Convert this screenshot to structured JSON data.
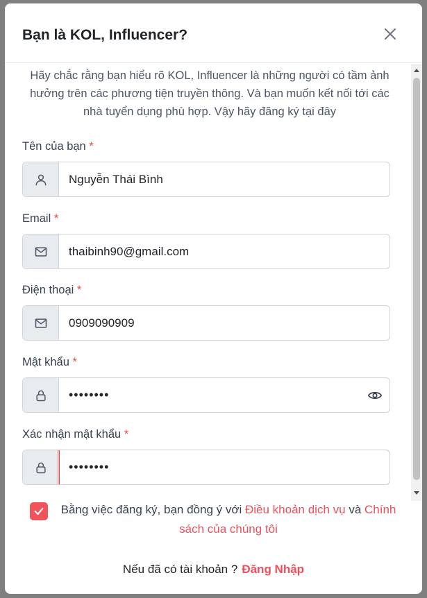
{
  "modal": {
    "title": "Bạn là KOL, Influencer?",
    "intro": "Hãy chắc rằng bạn hiểu rõ KOL, Influencer là những người có tầm ảnh hưởng trên các phương tiện truyền thông. Và bạn muốn kết nối tới các nhà tuyển dụng phù hợp. Vậy hãy đăng ký tại đây"
  },
  "fields": {
    "name": {
      "label": "Tên của bạn",
      "required": "*",
      "value": "Nguyễn Thái Bình",
      "icon": "user-icon"
    },
    "email": {
      "label": "Email",
      "required": "*",
      "value": "thaibinh90@gmail.com",
      "icon": "mail-icon"
    },
    "phone": {
      "label": "Điện thoại",
      "required": "*",
      "value": "0909090909",
      "icon": "mail-icon"
    },
    "password": {
      "label": "Mật khẩu",
      "required": "*",
      "value": "••••••••",
      "icon": "lock-icon"
    },
    "confirm": {
      "label": "Xác nhận mật khẩu",
      "required": "*",
      "value": "••••••••",
      "icon": "lock-icon"
    }
  },
  "consent": {
    "prefix": "Bằng việc đăng ký, bạn đồng ý với ",
    "terms": "Điều khoản dịch vụ",
    "and": " và ",
    "policy": "Chính sách của chúng tôi",
    "checked": true
  },
  "login": {
    "prompt": "Nếu đã có tài khoản ?",
    "link": "Đăng Nhập"
  },
  "colors": {
    "accent": "#ef4f5a",
    "required": "#ef4444",
    "addon_bg": "#e9ecef"
  }
}
